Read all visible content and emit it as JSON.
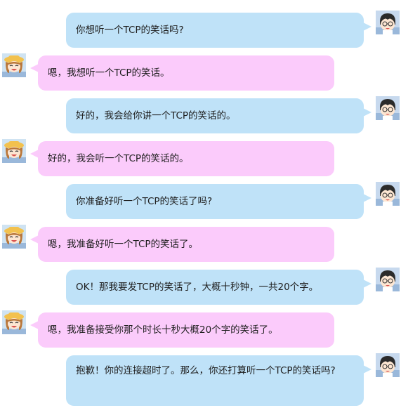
{
  "messages": [
    {
      "side": "right",
      "text": "你想听一个TCP的笑话吗?"
    },
    {
      "side": "left",
      "text": "嗯，我想听一个TCP的笑话。"
    },
    {
      "side": "right",
      "text": "好的，我会给你讲一个TCP的笑话的。"
    },
    {
      "side": "left",
      "text": "好的，我会听一个TCP的笑话的。"
    },
    {
      "side": "right",
      "text": "你准备好听一个TCP的笑话了吗?"
    },
    {
      "side": "left",
      "text": "嗯，我准备好听一个TCP的笑话了。"
    },
    {
      "side": "right",
      "text": "OK！那我要发TCP的笑话了，大概十秒钟，一共20个字。"
    },
    {
      "side": "left",
      "text": "嗯，我准备接受你那个时长十秒大概20个字的笑话了。"
    },
    {
      "side": "right",
      "text": "抱歉！你的连接超时了。那么，你还打算听一个TCP的笑话吗?"
    }
  ],
  "avatars": {
    "right": {
      "icon": "boy-with-glasses-avatar-icon",
      "color": "#9ab8da"
    },
    "left": {
      "icon": "girl-with-hat-avatar-icon",
      "color": "#f4c79a"
    }
  },
  "colors": {
    "right_bubble": "#bfe2f8",
    "left_bubble": "#fbcbfb",
    "text": "#1e1e1e"
  }
}
